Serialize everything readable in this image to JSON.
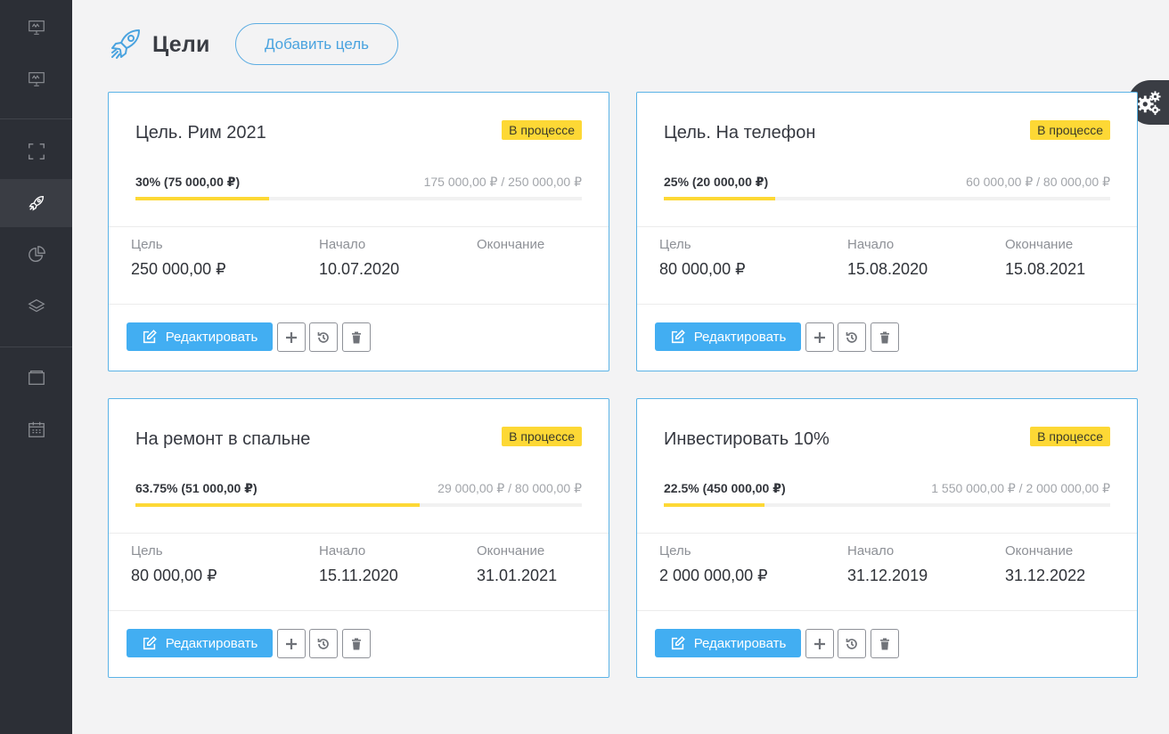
{
  "page": {
    "title": "Цели",
    "add_button": "Добавить цель"
  },
  "sidebar": {
    "items": [
      {
        "icon": "presentation-icon"
      },
      {
        "icon": "presentation-icon"
      },
      {
        "icon": "scan-frame-icon"
      },
      {
        "icon": "rocket-icon",
        "active": true
      },
      {
        "icon": "pie-chart-icon"
      },
      {
        "icon": "layers-icon"
      },
      {
        "icon": "wallet-icon"
      },
      {
        "icon": "calendar-icon"
      }
    ]
  },
  "settings_tab": {
    "icon": "gears-icon"
  },
  "colors": {
    "accent": "#42aef2",
    "badge": "#fdd835",
    "progress": "#fdd835",
    "sidebar": "#2c2f36"
  },
  "labels": {
    "goal": "Цель",
    "start": "Начало",
    "end": "Окончание",
    "edit": "Редактировать"
  },
  "goals": [
    {
      "title": "Цель. Рим 2021",
      "status": "В процессе",
      "percent_text": "30% (75 000,00 ₽)",
      "progress": 0.3,
      "amounts": "175 000,00 ₽ / 250 000,00 ₽",
      "goal_value": "250 000,00 ₽",
      "start_date": "10.07.2020",
      "end_date": ""
    },
    {
      "title": "Цель. На телефон",
      "status": "В процессе",
      "percent_text": "25% (20 000,00 ₽)",
      "progress": 0.25,
      "amounts": "60 000,00 ₽ / 80 000,00 ₽",
      "goal_value": "80 000,00 ₽",
      "start_date": "15.08.2020",
      "end_date": "15.08.2021"
    },
    {
      "title": "На ремонт в спальне",
      "status": "В процессе",
      "percent_text": "63.75% (51 000,00 ₽)",
      "progress": 0.6375,
      "amounts": "29 000,00 ₽ / 80 000,00 ₽",
      "goal_value": "80 000,00 ₽",
      "start_date": "15.11.2020",
      "end_date": "31.01.2021"
    },
    {
      "title": "Инвестировать 10%",
      "status": "В процессе",
      "percent_text": "22.5% (450 000,00 ₽)",
      "progress": 0.225,
      "amounts": "1 550 000,00 ₽ / 2 000 000,00 ₽",
      "goal_value": "2 000 000,00 ₽",
      "start_date": "31.12.2019",
      "end_date": "31.12.2022"
    }
  ]
}
